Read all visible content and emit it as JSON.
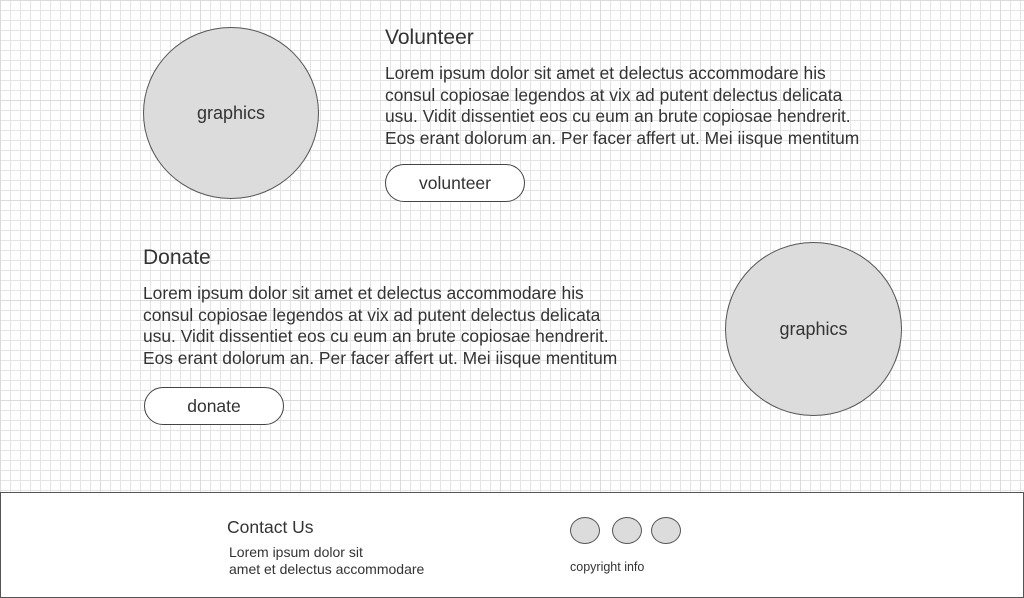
{
  "volunteer": {
    "graphic_label": "graphics",
    "heading": "Volunteer",
    "body_lines": [
      "Lorem ipsum dolor sit amet et delectus accommodare his",
      "consul copiosae legendos at vix ad putent delectus delicata",
      "usu. Vidit dissentiet eos cu eum an brute copiosae hendrerit.",
      "Eos erant dolorum an. Per facer affert ut. Mei iisque mentitum"
    ],
    "button_label": "volunteer"
  },
  "donate": {
    "graphic_label": "graphics",
    "heading": "Donate",
    "body_lines": [
      "Lorem ipsum dolor sit amet et delectus accommodare his",
      "consul copiosae legendos at vix ad putent delectus delicata",
      "usu. Vidit dissentiet eos cu eum an brute copiosae hendrerit.",
      "Eos erant dolorum an. Per facer affert ut. Mei iisque mentitum"
    ],
    "button_label": "donate"
  },
  "footer": {
    "contact_heading": "Contact Us",
    "contact_lines": [
      "Lorem ipsum dolor sit",
      "amet et delectus accommodare"
    ],
    "social_icons": [
      "social-icon-1",
      "social-icon-2",
      "social-icon-3"
    ],
    "copyright": "copyright info"
  },
  "colors": {
    "placeholder_fill": "#dcdcdc",
    "outline": "#555555",
    "text": "#333333",
    "grid": "#e4e4e4"
  }
}
